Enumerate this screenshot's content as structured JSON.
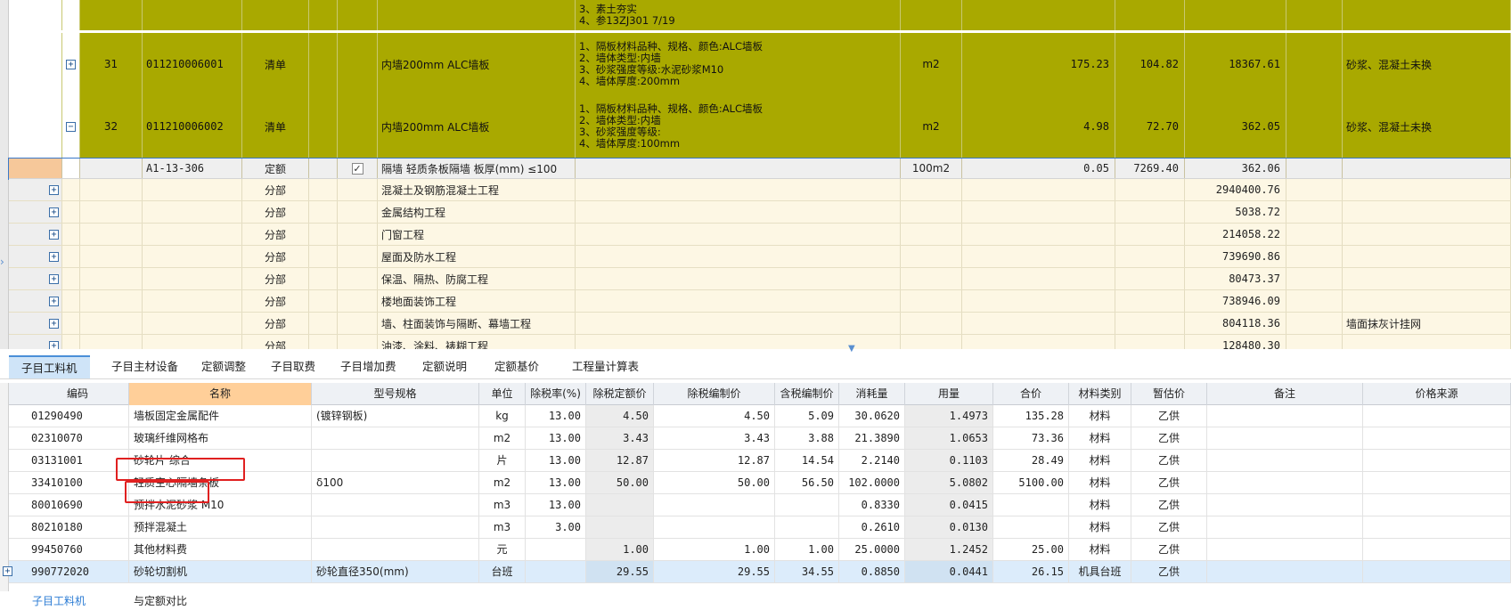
{
  "top_rows": [
    {
      "kind": "olive-partial",
      "desc": [
        "3、素土夯实",
        "4、参13ZJ301  7/19"
      ]
    },
    {
      "kind": "olive",
      "expander": "+",
      "no": "31",
      "code": "011210006001",
      "type": "清单",
      "name": "内墙200mm ALC墙板",
      "desc": [
        "1、隔板材料品种、规格、颜色:ALC墙板",
        "2、墙体类型:内墙",
        "3、砂浆强度等级:水泥砂浆M10",
        "4、墙体厚度:200mm"
      ],
      "unit": "m2",
      "qty": "175.23",
      "price": "104.82",
      "total": "18367.61",
      "note": "砂浆、混凝土未换"
    },
    {
      "kind": "olive",
      "expander": "−",
      "no": "32",
      "code": "011210006002",
      "type": "清单",
      "name": "内墙200mm ALC墙板",
      "desc": [
        "1、隔板材料品种、规格、颜色:ALC墙板",
        "2、墙体类型:内墙",
        "3、砂浆强度等级:",
        "4、墙体厚度:100mm"
      ],
      "unit": "m2",
      "qty": "4.98",
      "price": "72.70",
      "total": "362.05",
      "note": "砂浆、混凝土未换"
    },
    {
      "kind": "dinge",
      "code": "A1-13-306",
      "type": "定额",
      "check": "✓",
      "name": "隔墙 轻质条板隔墙 板厚(mm) ≤100",
      "unit": "100m2",
      "qty": "0.05",
      "price": "7269.40",
      "total": "362.06"
    },
    {
      "kind": "fen",
      "type": "分部",
      "name": "混凝土及钢筋混凝土工程",
      "total": "2940400.76"
    },
    {
      "kind": "fen",
      "type": "分部",
      "name": "金属结构工程",
      "total": "5038.72"
    },
    {
      "kind": "fen",
      "type": "分部",
      "name": "门窗工程",
      "total": "214058.22"
    },
    {
      "kind": "fen",
      "type": "分部",
      "name": "屋面及防水工程",
      "total": "739690.86"
    },
    {
      "kind": "fen",
      "type": "分部",
      "name": "保温、隔热、防腐工程",
      "total": "80473.37"
    },
    {
      "kind": "fen",
      "type": "分部",
      "name": "楼地面装饰工程",
      "total": "738946.09"
    },
    {
      "kind": "fen",
      "type": "分部",
      "name": "墙、柱面装饰与隔断、幕墙工程",
      "total": "804118.36",
      "note": "墙面抹灰计挂网"
    },
    {
      "kind": "fen",
      "type": "分部",
      "name": "油漆、涂料、裱糊工程",
      "total": "128480.30"
    }
  ],
  "tabs": [
    "子目工料机",
    "子目主材设备",
    "定额调整",
    "子目取费",
    "子目增加费",
    "定额说明",
    "定额基价",
    "工程量计算表"
  ],
  "active_tab": 0,
  "bottom_headers": [
    "编码",
    "名称",
    "型号规格",
    "单位",
    "除税率(%)",
    "除税定额价",
    "除税编制价",
    "含税编制价",
    "消耗量",
    "用量",
    "合价",
    "材料类别",
    "暂估价",
    "备注",
    "价格来源"
  ],
  "bottom_rows": [
    [
      "01290490",
      "墙板固定金属配件",
      "(镀锌钢板)",
      "kg",
      "13.00",
      "4.50",
      "4.50",
      "5.09",
      "30.0620",
      "1.4973",
      "135.28",
      "材料",
      "乙供",
      "",
      ""
    ],
    [
      "02310070",
      "玻璃纤维网格布",
      "",
      "m2",
      "13.00",
      "3.43",
      "3.43",
      "3.88",
      "21.3890",
      "1.0653",
      "73.36",
      "材料",
      "乙供",
      "",
      ""
    ],
    [
      "03131001",
      "砂轮片 综合",
      "",
      "片",
      "13.00",
      "12.87",
      "12.87",
      "14.54",
      "2.2140",
      "0.1103",
      "28.49",
      "材料",
      "乙供",
      "",
      ""
    ],
    [
      "33410100",
      "轻质空心隔墙条板",
      "δ100",
      "m2",
      "13.00",
      "50.00",
      "50.00",
      "56.50",
      "102.0000",
      "5.0802",
      "5100.00",
      "材料",
      "乙供",
      "",
      ""
    ],
    [
      "80010690",
      "预拌水泥砂浆 M10",
      "",
      "m3",
      "13.00",
      "",
      "",
      "",
      "0.8330",
      "0.0415",
      "",
      "材料",
      "乙供",
      "",
      ""
    ],
    [
      "80210180",
      "预拌混凝土",
      "",
      "m3",
      "3.00",
      "",
      "",
      "",
      "0.2610",
      "0.0130",
      "",
      "材料",
      "乙供",
      "",
      ""
    ],
    [
      "99450760",
      "其他材料费",
      "",
      "元",
      "",
      "1.00",
      "1.00",
      "1.00",
      "25.0000",
      "1.2452",
      "25.00",
      "材料",
      "乙供",
      "",
      ""
    ],
    [
      "990772020",
      "砂轮切割机",
      "砂轮直径350(mm)",
      "台班",
      "",
      "29.55",
      "29.55",
      "34.55",
      "0.8850",
      "0.0441",
      "26.15",
      "机具台班",
      "乙供",
      "",
      ""
    ]
  ],
  "bottom_tabs": [
    "子目工料机",
    "与定额对比"
  ]
}
